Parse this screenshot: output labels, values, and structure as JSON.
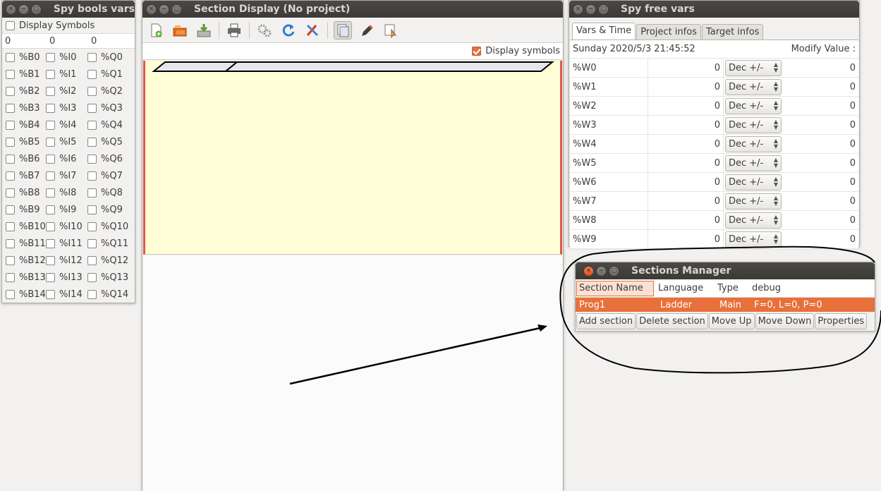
{
  "bools": {
    "title": "Spy bools vars",
    "display_symbols": "Display Symbols",
    "counts": [
      "0",
      "0",
      "0"
    ],
    "rows": [
      [
        "%B0",
        "%I0",
        "%Q0"
      ],
      [
        "%B1",
        "%I1",
        "%Q1"
      ],
      [
        "%B2",
        "%I2",
        "%Q2"
      ],
      [
        "%B3",
        "%I3",
        "%Q3"
      ],
      [
        "%B4",
        "%I4",
        "%Q4"
      ],
      [
        "%B5",
        "%I5",
        "%Q5"
      ],
      [
        "%B6",
        "%I6",
        "%Q6"
      ],
      [
        "%B7",
        "%I7",
        "%Q7"
      ],
      [
        "%B8",
        "%I8",
        "%Q8"
      ],
      [
        "%B9",
        "%I9",
        "%Q9"
      ],
      [
        "%B10",
        "%I10",
        "%Q10"
      ],
      [
        "%B11",
        "%I11",
        "%Q11"
      ],
      [
        "%B12",
        "%I12",
        "%Q12"
      ],
      [
        "%B13",
        "%I13",
        "%Q13"
      ],
      [
        "%B14",
        "%I14",
        "%Q14"
      ]
    ]
  },
  "section": {
    "title": "Section Display (No project)",
    "display_symbols": "Display symbols"
  },
  "free": {
    "title": "Spy free vars",
    "tabs": [
      "Vars & Time",
      "Project infos",
      "Target infos"
    ],
    "datetime": "Sunday 2020/5/3 21:45:52",
    "modify_label": "Modify Value :",
    "rows": [
      {
        "name": "%W0",
        "value": "0",
        "fmt": "Dec +/-",
        "mod": "0"
      },
      {
        "name": "%W1",
        "value": "0",
        "fmt": "Dec +/-",
        "mod": "0"
      },
      {
        "name": "%W2",
        "value": "0",
        "fmt": "Dec +/-",
        "mod": "0"
      },
      {
        "name": "%W3",
        "value": "0",
        "fmt": "Dec +/-",
        "mod": "0"
      },
      {
        "name": "%W4",
        "value": "0",
        "fmt": "Dec +/-",
        "mod": "0"
      },
      {
        "name": "%W5",
        "value": "0",
        "fmt": "Dec +/-",
        "mod": "0"
      },
      {
        "name": "%W6",
        "value": "0",
        "fmt": "Dec +/-",
        "mod": "0"
      },
      {
        "name": "%W7",
        "value": "0",
        "fmt": "Dec +/-",
        "mod": "0"
      },
      {
        "name": "%W8",
        "value": "0",
        "fmt": "Dec +/-",
        "mod": "0"
      },
      {
        "name": "%W9",
        "value": "0",
        "fmt": "Dec +/-",
        "mod": "0"
      }
    ]
  },
  "manager": {
    "title": "Sections Manager",
    "headers": [
      "Section Name",
      "Language",
      "Type",
      "debug"
    ],
    "row": [
      "Prog1",
      "Ladder",
      "Main",
      "F=0, L=0, P=0"
    ],
    "buttons": [
      "Add section",
      "Delete section",
      "Move Up",
      "Move Down",
      "Properties"
    ]
  },
  "colors": {
    "accent": "#e8703a",
    "ladder_bg": "#fffed6",
    "titlebar": "#3c3b37"
  }
}
